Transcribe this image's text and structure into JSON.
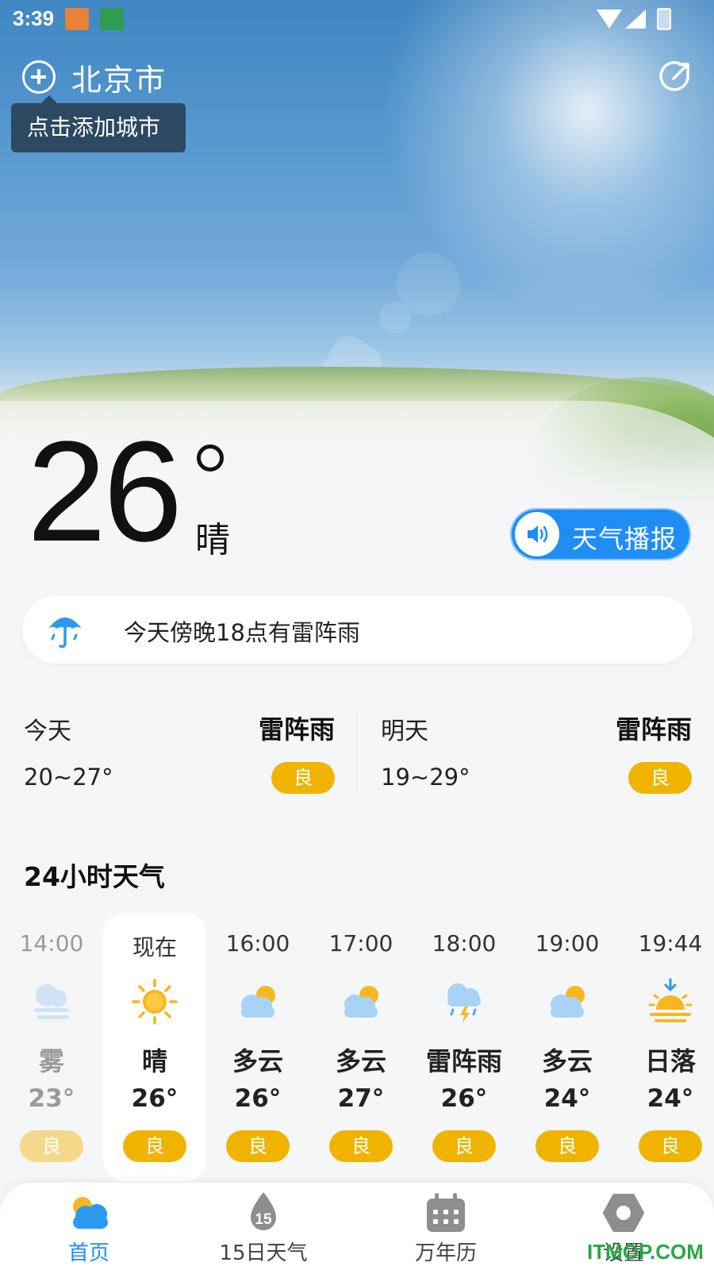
{
  "status_bar": {
    "time": "3:39"
  },
  "header": {
    "city": "北京市",
    "tooltip": "点击添加城市"
  },
  "current": {
    "temperature": "26",
    "condition": "晴",
    "broadcast_label": "天气播报"
  },
  "alert": {
    "text": "今天傍晚18点有雷阵雨"
  },
  "days": [
    {
      "name": "今天",
      "weather": "雷阵雨",
      "range": "20~27°",
      "aqi": "良"
    },
    {
      "name": "明天",
      "weather": "雷阵雨",
      "range": "19~29°",
      "aqi": "良"
    }
  ],
  "hourly_title": "24小时天气",
  "hourly": [
    {
      "time": "14:00",
      "icon": "fog-icon",
      "weather": "雾",
      "temp": "23°",
      "aqi": "良",
      "state": "past"
    },
    {
      "time": "现在",
      "icon": "sunny-icon",
      "weather": "晴",
      "temp": "26°",
      "aqi": "良",
      "state": "now"
    },
    {
      "time": "16:00",
      "icon": "partly-cloudy-icon",
      "weather": "多云",
      "temp": "26°",
      "aqi": "良",
      "state": "future"
    },
    {
      "time": "17:00",
      "icon": "partly-cloudy-icon",
      "weather": "多云",
      "temp": "27°",
      "aqi": "良",
      "state": "future"
    },
    {
      "time": "18:00",
      "icon": "thunderstorm-icon",
      "weather": "雷阵雨",
      "temp": "26°",
      "aqi": "良",
      "state": "future"
    },
    {
      "time": "19:00",
      "icon": "partly-cloudy-icon",
      "weather": "多云",
      "temp": "24°",
      "aqi": "良",
      "state": "future"
    },
    {
      "time": "19:44",
      "icon": "sunset-icon",
      "weather": "日落",
      "temp": "24°",
      "aqi": "良",
      "state": "future"
    }
  ],
  "nav": [
    {
      "label": "首页",
      "icon": "home-weather-icon",
      "active": true
    },
    {
      "label": "15日天气",
      "icon": "fifteen-day-icon",
      "badge": "15",
      "active": false
    },
    {
      "label": "万年历",
      "icon": "calendar-icon",
      "active": false
    },
    {
      "label": "设置",
      "icon": "settings-icon",
      "active": false
    }
  ],
  "watermark": "ITMOP.COM",
  "colors": {
    "accent": "#1e8ef5",
    "aqi_good": "#f0b400",
    "aqi_good_faded": "#f5d98a",
    "watermark": "#27a845"
  }
}
